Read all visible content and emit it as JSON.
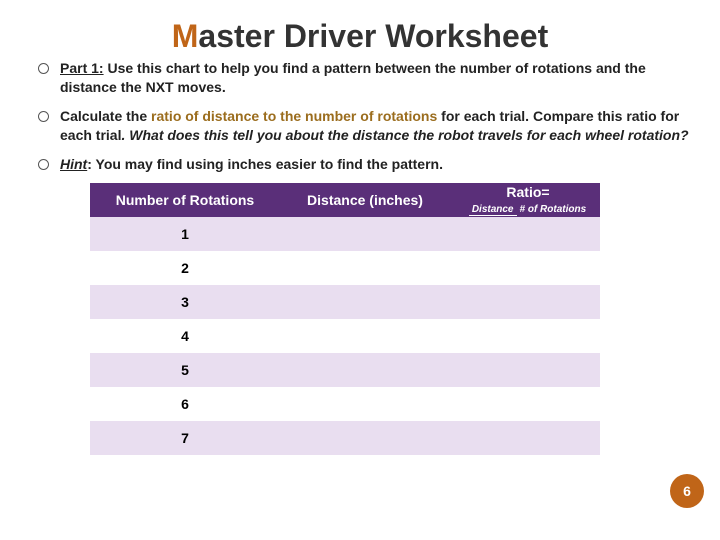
{
  "title_first_letter": "M",
  "title_rest": "aster Driver Worksheet",
  "bullets": {
    "b1_a": "Part 1:",
    "b1_b": " Use this chart to help you find a pattern between the number of rotations and the distance the NXT moves.",
    "b2_a": "Calculate the ",
    "b2_b": "ratio of distance to the number of rotations",
    "b2_c": " for each trial. Compare this ratio for each trial",
    "b2_d": ". What does this tell you about the distance the robot travels for each wheel rotation?",
    "b3_a": "Hint",
    "b3_b": ": You may find using inches easier to find the pattern."
  },
  "headers": {
    "h1": "Number of Rotations",
    "h2": "Distance (inches)",
    "h3_label": "Ratio=",
    "h3_top": "Distance",
    "h3_bot": "# of Rotations"
  },
  "rows": [
    "1",
    "2",
    "3",
    "4",
    "5",
    "6",
    "7"
  ],
  "page_number": "6"
}
